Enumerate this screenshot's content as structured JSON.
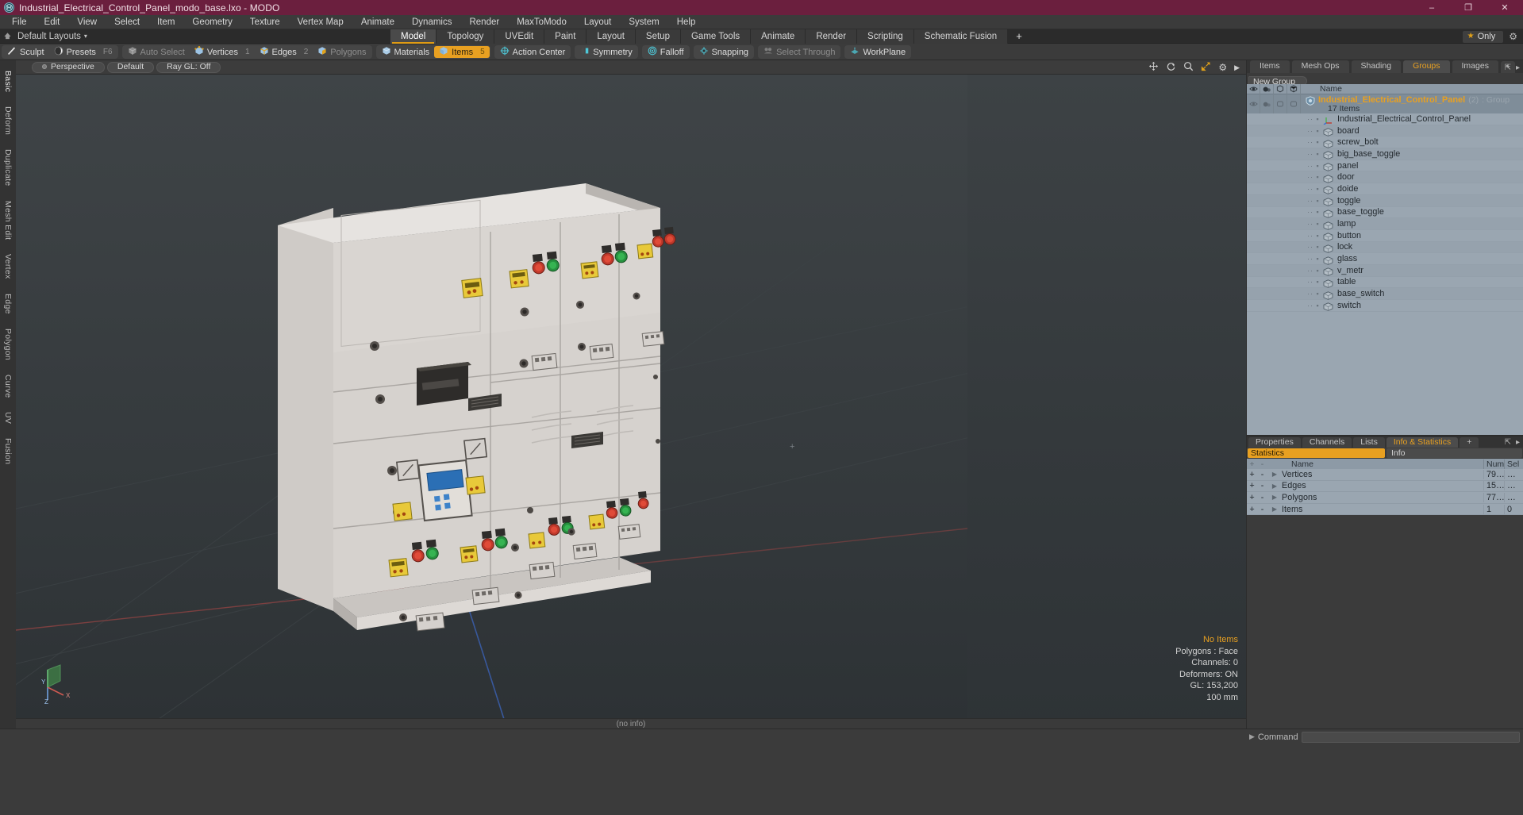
{
  "titlebar": {
    "title": "Industrial_Electrical_Control_Panel_modo_base.lxo - MODO",
    "app_icon": "modo-logo-icon",
    "minimize": "–",
    "maximize": "❐",
    "close": "✕"
  },
  "menubar": {
    "items": [
      "File",
      "Edit",
      "View",
      "Select",
      "Item",
      "Geometry",
      "Texture",
      "Vertex Map",
      "Animate",
      "Dynamics",
      "Render",
      "MaxToModo",
      "Layout",
      "System",
      "Help"
    ]
  },
  "layoutbar": {
    "home_icon": "home-icon",
    "label": "Default Layouts",
    "caret": "▾",
    "tabs": [
      "Model",
      "Topology",
      "UVEdit",
      "Paint",
      "Layout",
      "Setup",
      "Game Tools",
      "Animate",
      "Render",
      "Scripting",
      "Schematic Fusion"
    ],
    "active_tab": "Model",
    "plus": "+",
    "only_label": "Only",
    "star_icon": "star-icon",
    "gear_icon": "gear-icon"
  },
  "toolbar": {
    "groups": [
      {
        "buttons": [
          {
            "label": "Sculpt",
            "icon": "sculpt-icon",
            "state": "normal",
            "num": ""
          },
          {
            "label": "Presets",
            "icon": "presets-sphere-icon",
            "state": "normal",
            "num": "F6"
          }
        ]
      },
      {
        "buttons": [
          {
            "label": "Auto Select",
            "icon": "cube-grey-icon",
            "state": "dim",
            "num": ""
          },
          {
            "label": "Vertices",
            "icon": "cube-vertex-icon",
            "state": "normal",
            "num": "1"
          },
          {
            "label": "Edges",
            "icon": "cube-edge-icon",
            "state": "normal",
            "num": "2"
          },
          {
            "label": "Polygons",
            "icon": "cube-poly-icon",
            "state": "dim",
            "num": ""
          }
        ]
      },
      {
        "buttons": [
          {
            "label": "Materials",
            "icon": "cube-material-icon",
            "state": "normal",
            "num": ""
          },
          {
            "label": "Items",
            "icon": "cube-items-icon",
            "state": "selected",
            "num": "5"
          }
        ]
      },
      {
        "buttons": [
          {
            "label": "Action Center",
            "icon": "crosshair-icon",
            "state": "normal",
            "num": ""
          }
        ]
      },
      {
        "buttons": [
          {
            "label": "Symmetry",
            "icon": "symmetry-icon",
            "state": "normal",
            "num": ""
          }
        ]
      },
      {
        "buttons": [
          {
            "label": "Falloff",
            "icon": "falloff-target-icon",
            "state": "normal",
            "num": ""
          }
        ]
      },
      {
        "buttons": [
          {
            "label": "Snapping",
            "icon": "snapping-icon",
            "state": "normal",
            "num": ""
          }
        ]
      },
      {
        "buttons": [
          {
            "label": "Select Through",
            "icon": "select-through-icon",
            "state": "dim",
            "num": ""
          }
        ]
      },
      {
        "buttons": [
          {
            "label": "WorkPlane",
            "icon": "workplane-icon",
            "state": "normal",
            "num": ""
          }
        ]
      }
    ]
  },
  "left_tabs": {
    "items": [
      "Basic",
      "Deform",
      "Duplicate",
      "Mesh Edit",
      "Vertex",
      "Edge",
      "Polygon",
      "Curve",
      "UV",
      "Fusion"
    ]
  },
  "viewport": {
    "pills": [
      {
        "label": "Perspective",
        "dot": true
      },
      {
        "label": "Default",
        "dot": false
      },
      {
        "label": "Ray GL: Off",
        "dot": false
      }
    ],
    "icons": [
      "move-icon",
      "rotate-icon",
      "zoom-icon",
      "fit-icon",
      "gear-icon",
      "play-icon"
    ],
    "overlay": {
      "items_status": "No Items",
      "polygons": "Polygons : Face",
      "channels": "Channels: 0",
      "deformers": "Deformers: ON",
      "gl": "GL: 153,200",
      "grid": "100 mm"
    },
    "axis": {
      "x": "X",
      "y": "Y",
      "z": "Z"
    },
    "footer": "(no info)"
  },
  "right_panel": {
    "tabs": [
      "Items",
      "Mesh Ops",
      "Shading",
      "Groups",
      "Images"
    ],
    "active_tab": "Groups",
    "plus": "+",
    "expand_icon": "expand-icon",
    "more_icon": "chevron-right-icon",
    "new_group_button": "New Group",
    "columns": {
      "vis": "eye-icon",
      "shade": "shade-icon",
      "lock": "cube-outline-icon",
      "sel": "cube-outline-2-icon",
      "name": "Name"
    },
    "group": {
      "name": "Industrial_Electrical_Control_Panel",
      "count": "(2)",
      "type": ": Group",
      "subtitle": "17 Items",
      "icon": "group-shield-icon"
    },
    "items": [
      {
        "name": "Industrial_Electrical_Control_Panel",
        "icon": "locator-axis-icon"
      },
      {
        "name": "board",
        "icon": "mesh-cube-icon"
      },
      {
        "name": "screw_bolt",
        "icon": "mesh-cube-icon"
      },
      {
        "name": "big_base_toggle",
        "icon": "mesh-cube-icon"
      },
      {
        "name": "panel",
        "icon": "mesh-cube-icon"
      },
      {
        "name": "door",
        "icon": "mesh-cube-icon"
      },
      {
        "name": "doide",
        "icon": "mesh-cube-icon"
      },
      {
        "name": "toggle",
        "icon": "mesh-cube-icon"
      },
      {
        "name": "base_toggle",
        "icon": "mesh-cube-icon"
      },
      {
        "name": "lamp",
        "icon": "mesh-cube-icon"
      },
      {
        "name": "button",
        "icon": "mesh-cube-icon"
      },
      {
        "name": "lock",
        "icon": "mesh-cube-icon"
      },
      {
        "name": "glass",
        "icon": "mesh-cube-icon"
      },
      {
        "name": "v_metr",
        "icon": "mesh-cube-icon"
      },
      {
        "name": "table",
        "icon": "mesh-cube-icon"
      },
      {
        "name": "base_switch",
        "icon": "mesh-cube-icon"
      },
      {
        "name": "switch",
        "icon": "mesh-cube-icon"
      }
    ]
  },
  "stats_panel": {
    "tabs": [
      "Properties",
      "Channels",
      "Lists",
      "Info & Statistics"
    ],
    "active_tab": "Info & Statistics",
    "plus": "+",
    "expand_icon": "expand-icon",
    "more_icon": "chevron-right-icon",
    "filter_active": "Statistics",
    "filter_inactive": "Info",
    "columns": {
      "plus": "+",
      "minus": "-",
      "name": "Name",
      "num": "Num",
      "sel": "Sel"
    },
    "rows": [
      {
        "name": "Vertices",
        "num": "79…",
        "sel": "…"
      },
      {
        "name": "Edges",
        "num": "15…",
        "sel": "…"
      },
      {
        "name": "Polygons",
        "num": "77…",
        "sel": "…"
      },
      {
        "name": "Items",
        "num": "1",
        "sel": "0"
      }
    ]
  },
  "bottombar": {
    "command_label": "Command",
    "command_value": "",
    "arrow": "▶"
  },
  "colors": {
    "title_bg": "#6b1f3e",
    "accent": "#e8a021",
    "panel_list_bg": "#9aa6b1",
    "viewport_bg": "#34393c"
  }
}
